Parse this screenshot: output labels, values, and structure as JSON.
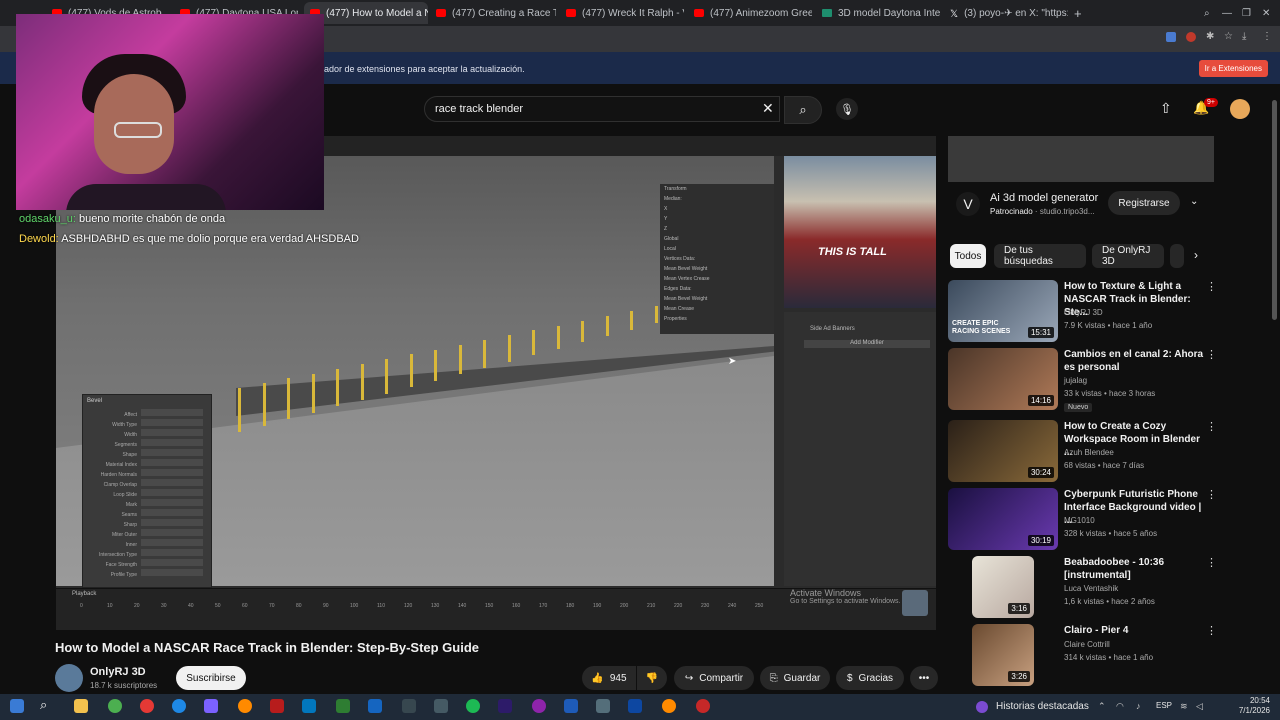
{
  "browser": {
    "tabs": [
      {
        "label": "(477) Vods de Astrobot"
      },
      {
        "label": "(477) Daytona USA Longs"
      },
      {
        "label": "(477) How to Model a NAS"
      },
      {
        "label": "(477) Creating a Race Tra"
      },
      {
        "label": "(477) Wreck It Ralph - Van"
      },
      {
        "label": "(477) Animezoom Green S"
      },
      {
        "label": "3D model Daytona Interna"
      },
      {
        "label": "(3) poyo-✈ en X: \"https://t"
      }
    ],
    "new_tab": "+"
  },
  "ext_bar": {
    "message": "ador de extensiones para aceptar la actualización.",
    "button": "Ir a Extensiones"
  },
  "youtube": {
    "search_value": "race track blender",
    "notifications": "9+"
  },
  "stream_chat": [
    {
      "user": "odasaku_u:",
      "text": "bueno morite chabón de onda"
    },
    {
      "user": "Dewold:",
      "text": "ASBHDABHD es que me dolio porque era verdad AHSDBAD"
    }
  ],
  "video": {
    "title": "How to Model a NASCAR Race Track in Blender: Step-By-Step Guide",
    "channel": "OnlyRJ 3D",
    "subs": "18.7 k suscriptores",
    "subscribe": "Suscribirse",
    "likes": "945",
    "share": "Compartir",
    "save": "Guardar",
    "thanks": "Gracias",
    "more": "•••",
    "watermark_line1": "Activate Windows",
    "watermark_line2": "Go to Settings to activate Windows.",
    "blender": {
      "bevel_title": "Bevel",
      "bevel_rows": [
        "Affect",
        "Width Type",
        "Width",
        "Segments",
        "Shape",
        "Material Index",
        "Harden Normals",
        "Clamp Overlap",
        "Loop Slide",
        "Mark",
        "Seams",
        "Sharp",
        "Miter Outer",
        "Inner",
        "Intersection Type",
        "Face Strength",
        "Profile Type"
      ],
      "panel_rows": [
        "Transform",
        "Median:",
        "X",
        "Y",
        "Z",
        "Global",
        "Local",
        "Vertices Data:",
        "Mean Bevel Weight",
        "Mean Vertex Crease",
        "Edges Data:",
        "Mean Bevel Weight",
        "Mean Crease",
        "Properties"
      ],
      "timeline_label": "Playback",
      "ticks": [
        "0",
        "10",
        "20",
        "30",
        "40",
        "50",
        "60",
        "70",
        "80",
        "90",
        "100",
        "110",
        "120",
        "130",
        "140",
        "150",
        "160",
        "170",
        "180",
        "190",
        "200",
        "210",
        "220",
        "230",
        "240",
        "250"
      ],
      "modifier": "Side Ad Banners",
      "add_modifier": "Add Modifier",
      "photo_text": "THIS IS TALL"
    }
  },
  "sidebar": {
    "ad": {
      "title": "Ai 3d model generator",
      "sponsored": "Patrocinado",
      "domain": "studio.tripo3d...",
      "cta": "Registrarse"
    },
    "chips": [
      "Todos",
      "De tus búsquedas",
      "De OnlyRJ 3D"
    ],
    "recs": [
      {
        "title": "How to Texture & Light a NASCAR Track in Blender: Ste...",
        "channel": "OnlyRJ 3D",
        "meta": "7.9 K vistas • hace 1 año",
        "duration": "15:31",
        "thumb_text": "CREATE EPIC RACING SCENES"
      },
      {
        "title": "Cambios en el canal 2: Ahora es personal",
        "channel": "jujalag",
        "meta": "33 k vistas • hace 3 horas",
        "duration": "14:16",
        "badge": "Nuevo"
      },
      {
        "title": "How to Create a Cozy Workspace Room in Blender ...",
        "channel": "Azuh Blendee",
        "meta": "68 vistas • hace 7 días",
        "duration": "30:24"
      },
      {
        "title": "Cyberpunk Futuristic Phone Interface Background video | ...",
        "channel": "MG1010",
        "meta": "328 k vistas • hace 5 años",
        "duration": "30:19"
      },
      {
        "title": "Beabadoobee - 10:36 [instrumental]",
        "channel": "Luca Ventashik",
        "meta": "1,6 k vistas • hace 2 años",
        "duration": "3:16"
      },
      {
        "title": "Clairo - Pier 4",
        "channel": "Claire Cottrill",
        "meta": "314 k vistas • hace 1 año",
        "duration": "3:26"
      }
    ]
  },
  "taskbar": {
    "news": "Historias destacadas",
    "lang": "ESP",
    "time": "20:54",
    "date": "7/1/2026"
  }
}
